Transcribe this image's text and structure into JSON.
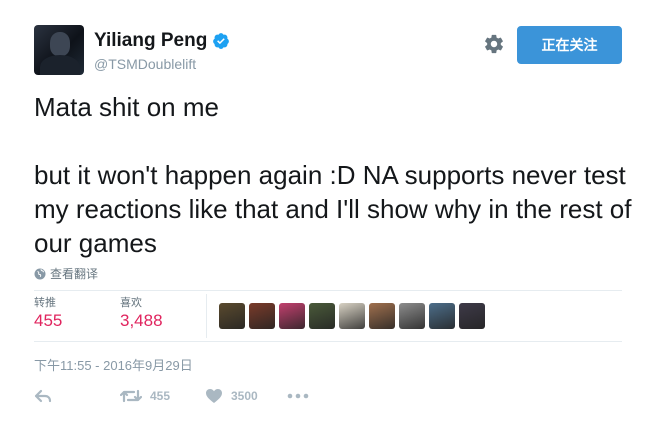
{
  "user": {
    "name": "Yiliang Peng",
    "handle": "@TSMDoublelift",
    "verified": true
  },
  "header": {
    "follow_label": "正在关注"
  },
  "tweet": {
    "paragraphs": [
      "Mata shit on me",
      "but it won't happen again :D NA supports never test my reactions like that and I'll show why in the rest of our games"
    ],
    "translate_label": "查看翻译"
  },
  "stats": {
    "retweets_label": "转推",
    "retweets_value": "455",
    "likes_label": "喜欢",
    "likes_value": "3,488"
  },
  "likers": [
    {
      "icon": "liker-avatar",
      "color": "#5a4a2e"
    },
    {
      "icon": "liker-avatar",
      "color": "#7a3b2a"
    },
    {
      "icon": "liker-avatar",
      "color": "#c2406e"
    },
    {
      "icon": "liker-avatar",
      "color": "#4a5a3a"
    },
    {
      "icon": "liker-avatar",
      "color": "#d8d2c4"
    },
    {
      "icon": "liker-avatar",
      "color": "#a0704e"
    },
    {
      "icon": "liker-avatar",
      "color": "#8d8d8d"
    },
    {
      "icon": "liker-avatar",
      "color": "#4d6e8a"
    },
    {
      "icon": "liker-avatar",
      "color": "#3e3a48"
    }
  ],
  "timestamp": "下午11:55 - 2016年9月29日",
  "actions": {
    "retweet_count": "455",
    "like_count": "3500"
  },
  "colors": {
    "accent": "#3b94d9",
    "stat_value": "#e0245e",
    "muted": "#8899a6",
    "action_icon": "#aab8c2"
  }
}
